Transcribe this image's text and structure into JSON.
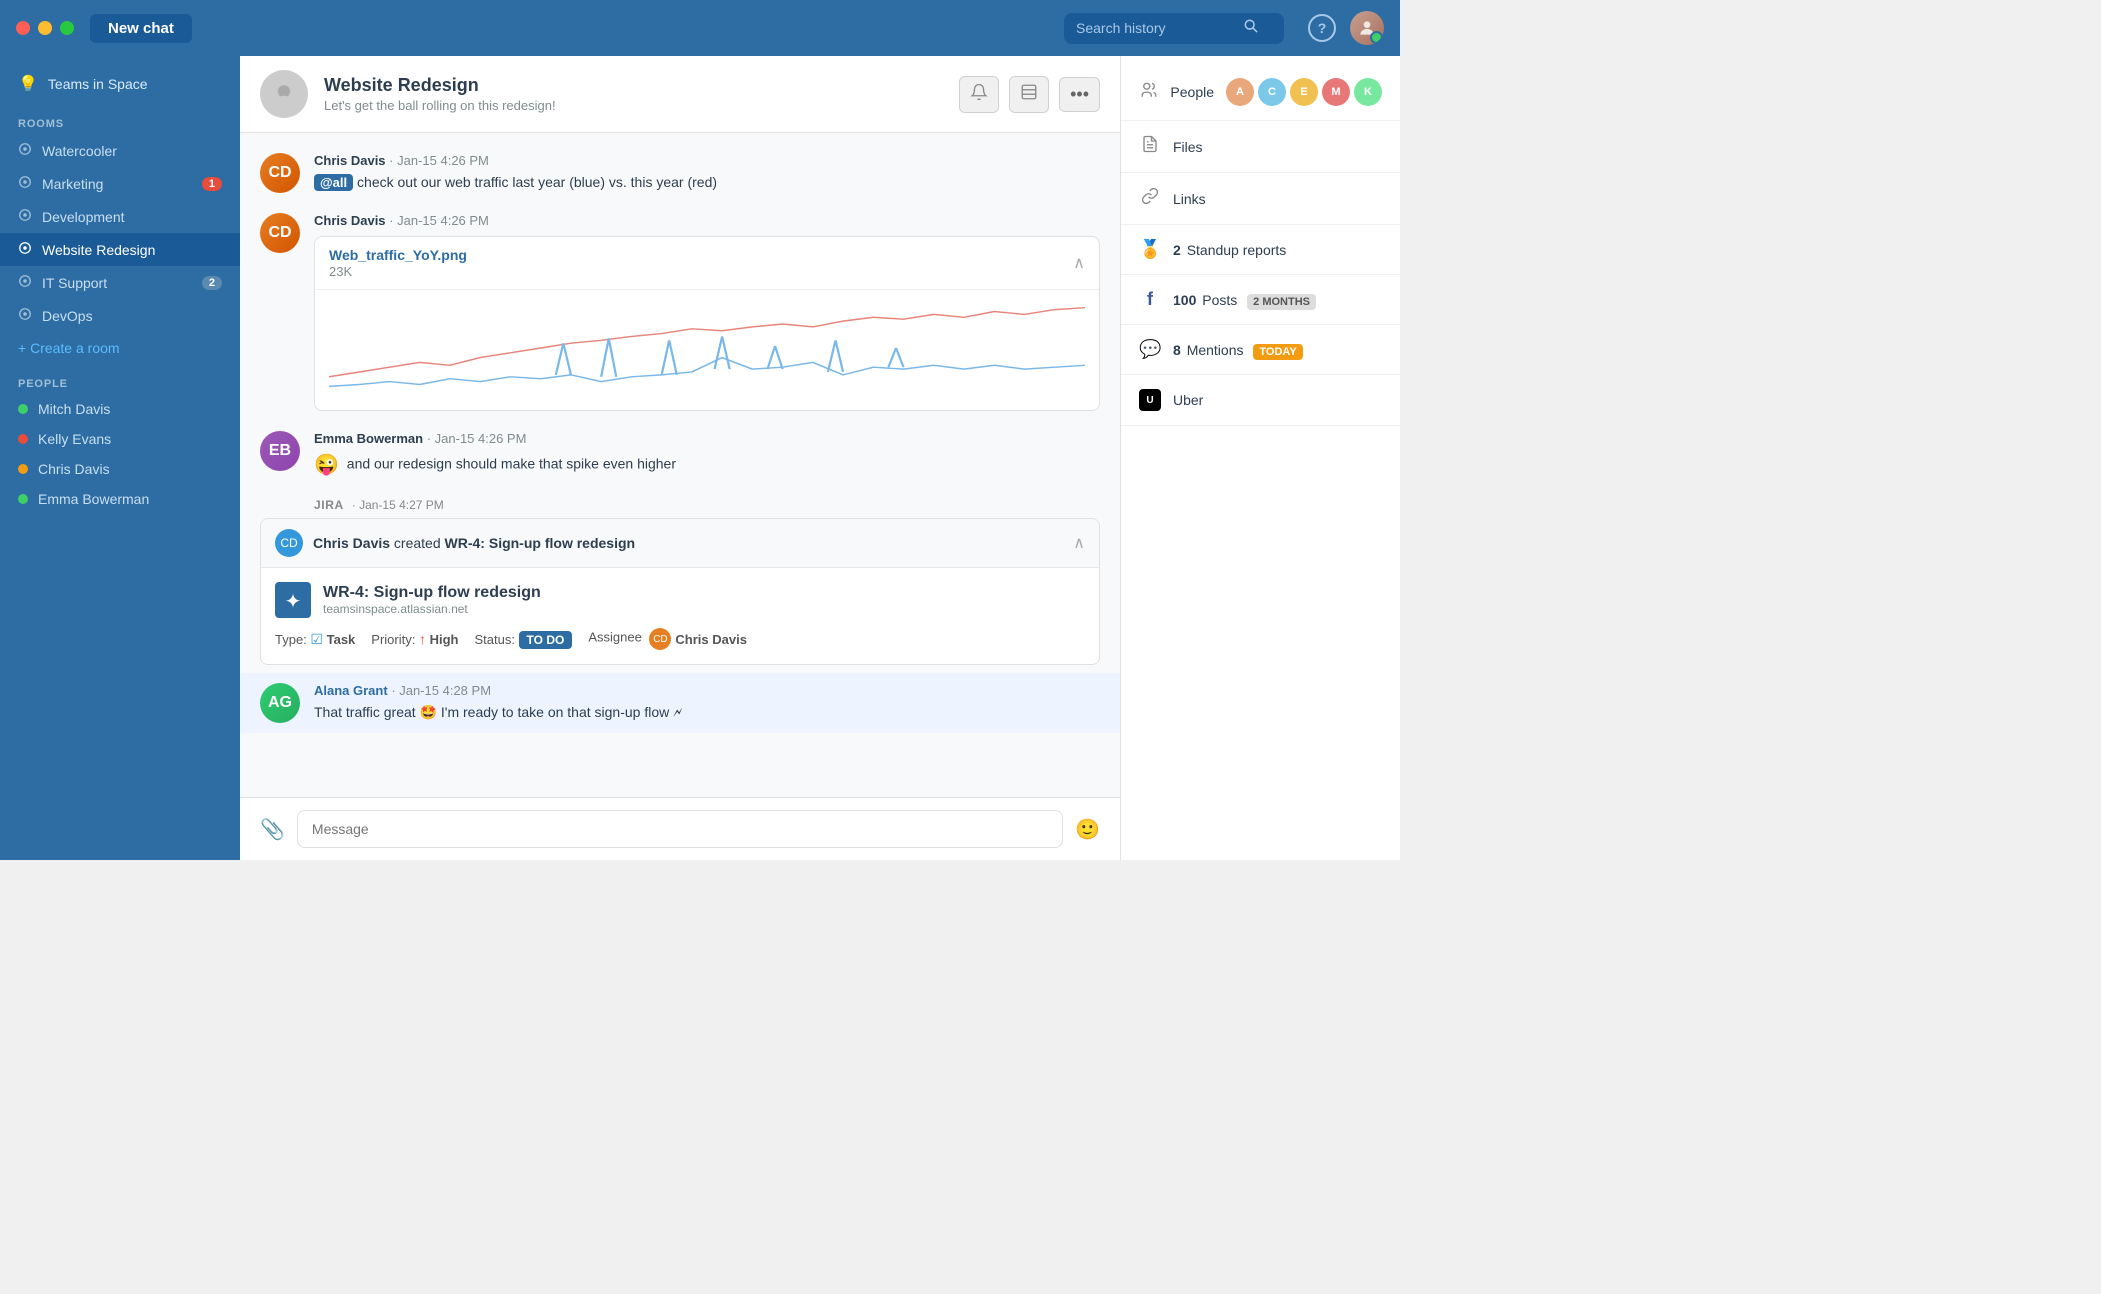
{
  "titlebar": {
    "new_chat_label": "New chat",
    "search_placeholder": "Search history"
  },
  "sidebar": {
    "team_name": "Teams in Space",
    "rooms_header": "ROOMS",
    "rooms": [
      {
        "id": "watercooler",
        "label": "Watercooler",
        "badge": null
      },
      {
        "id": "marketing",
        "label": "Marketing",
        "badge": "1"
      },
      {
        "id": "development",
        "label": "Development",
        "badge": null
      },
      {
        "id": "website-redesign",
        "label": "Website Redesign",
        "badge": null,
        "active": true
      },
      {
        "id": "it-support",
        "label": "IT Support",
        "badge": "2"
      },
      {
        "id": "devops",
        "label": "DevOps",
        "badge": null
      }
    ],
    "create_room_label": "+ Create a room",
    "people_header": "PEOPLE",
    "people": [
      {
        "id": "mitch-davis",
        "name": "Mitch Davis",
        "status": "green"
      },
      {
        "id": "kelly-evans",
        "name": "Kelly Evans",
        "status": "red"
      },
      {
        "id": "chris-davis",
        "name": "Chris Davis",
        "status": "orange"
      },
      {
        "id": "emma-bowerman",
        "name": "Emma Bowerman",
        "status": "green"
      }
    ]
  },
  "chat": {
    "room_name": "Website Redesign",
    "room_description": "Let's get the ball rolling on this redesign!",
    "messages": [
      {
        "id": "msg1",
        "sender": "Chris Davis",
        "time": "Jan-15 4:26 PM",
        "mention": "@all",
        "text": " check out our web traffic last year (blue) vs. this year (red)",
        "has_attachment": false
      },
      {
        "id": "msg2",
        "sender": "Chris Davis",
        "time": "Jan-15 4:26 PM",
        "text": "",
        "has_attachment": true,
        "attachment_name": "Web_traffic_YoY.png",
        "attachment_size": "23K"
      },
      {
        "id": "msg3",
        "sender": "Emma Bowerman",
        "time": "Jan-15 4:26 PM",
        "emoji": "😜",
        "text": "and our redesign should make that spike even higher"
      },
      {
        "id": "msg4-jira",
        "type": "jira",
        "integration": "JIRA",
        "time": "Jan-15 4:27 PM",
        "creator": "Chris Davis",
        "action": "created",
        "issue_key": "WR-4: Sign-up flow redesign",
        "issue_title": "WR-4: Sign-up flow redesign",
        "issue_url": "teamsinspace.atlassian.net",
        "type_label": "Task",
        "priority_label": "High",
        "status_label": "TO DO",
        "assignee": "Chris Davis"
      },
      {
        "id": "msg5",
        "sender": "Alana Grant",
        "time": "Jan-15 4:28 PM",
        "text": "That traffic great 🤩 I'm ready to take on that sign-up flow 🗲",
        "highlighted": true
      }
    ],
    "input_placeholder": "Message"
  },
  "right_sidebar": {
    "people_label": "People",
    "files_label": "Files",
    "links_label": "Links",
    "standup_label": "Standup reports",
    "standup_count": "2",
    "posts_label": "Posts",
    "posts_count": "100",
    "posts_badge": "2 MONTHS",
    "mentions_label": "Mentions",
    "mentions_count": "8",
    "mentions_badge": "TODAY",
    "uber_label": "Uber"
  }
}
